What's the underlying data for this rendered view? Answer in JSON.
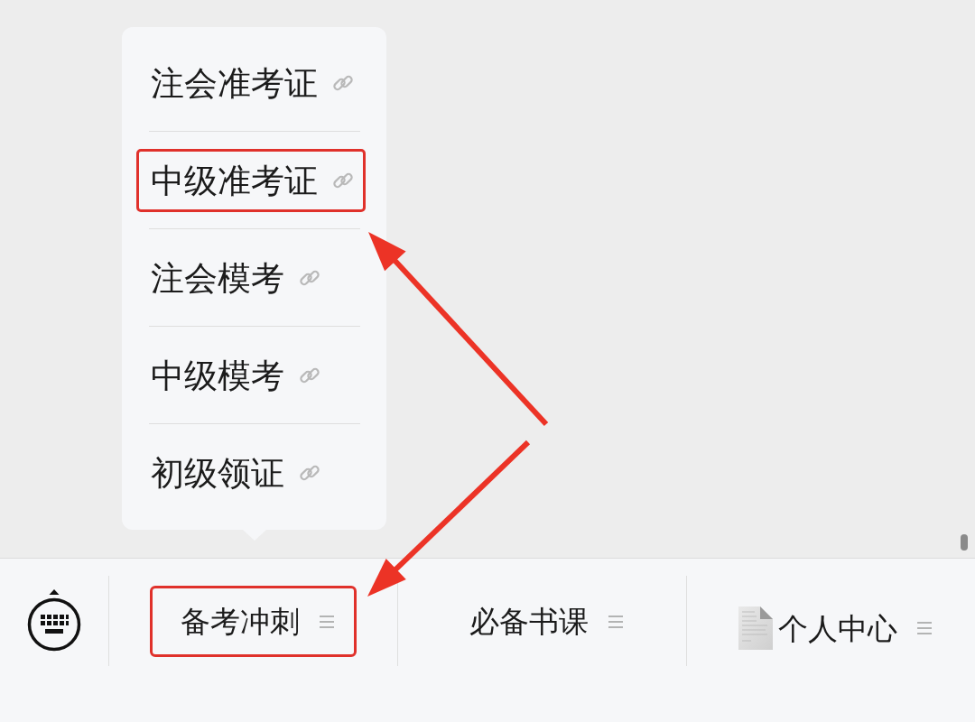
{
  "menu_bar": {
    "tabs": [
      {
        "label": "备考冲刺",
        "kind": "text",
        "highlighted": true,
        "submenu": [
          {
            "label": "注会准考证",
            "highlighted": false
          },
          {
            "label": "中级准考证",
            "highlighted": true
          },
          {
            "label": "注会模考",
            "highlighted": false
          },
          {
            "label": "中级模考",
            "highlighted": false
          },
          {
            "label": "初级领证",
            "highlighted": false
          }
        ]
      },
      {
        "label": "必备书课",
        "kind": "text",
        "highlighted": false
      },
      {
        "label": "个人中心",
        "kind": "icon_text",
        "highlighted": false
      }
    ]
  }
}
